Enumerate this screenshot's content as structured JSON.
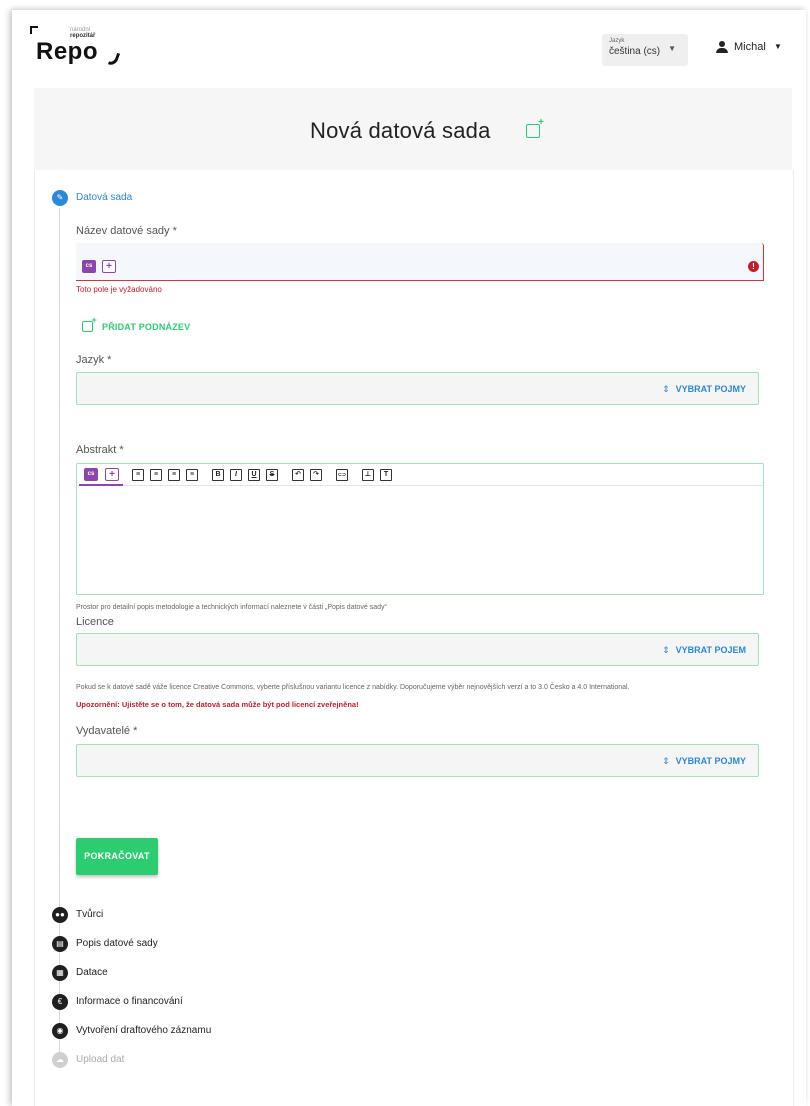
{
  "header": {
    "logo": {
      "small_line1": "národní",
      "small_line2": "repozitář",
      "name": "Repo"
    },
    "language": {
      "label": "Jazyk",
      "value": "čeština (cs)"
    },
    "user": {
      "name": "Michal"
    }
  },
  "page_title": "Nová datová sada",
  "steps": [
    {
      "label": "Datová sada",
      "state": "active"
    },
    {
      "label": "Tvůrci",
      "state": "pending"
    },
    {
      "label": "Popis datové sady",
      "state": "pending"
    },
    {
      "label": "Datace",
      "state": "pending"
    },
    {
      "label": "Informace o financování",
      "state": "pending"
    },
    {
      "label": "Vytvoření draftového záznamu",
      "state": "pending"
    },
    {
      "label": "Upload dat",
      "state": "disabled"
    }
  ],
  "form": {
    "name": {
      "label": "Název datové sady *",
      "lang_chip": "cs",
      "add_chip": "+",
      "error": "Toto pole je vyžadováno",
      "add_subtitle": "PŘIDAT PODNÁZEV"
    },
    "language": {
      "label": "Jazyk *",
      "action": "VYBRAT POJMY"
    },
    "abstract": {
      "label": "Abstrakt *",
      "lang_chip": "cs",
      "add_chip": "+",
      "help": "Prostor pro detailní popis metodologie a technických informací naleznete v části „Popis datové sady“",
      "toolbar": [
        "≡",
        "≡",
        "≡",
        "≡",
        "B",
        "I",
        "U",
        "S",
        "↶",
        "↷",
        "⊂⊃",
        "⊥",
        "T"
      ]
    },
    "license": {
      "label": "Licence",
      "action": "VYBRAT POJEM",
      "help": "Pokud se k datové sadě váže licence Creative Commons, vyberte příslušnou variantu licence z nabídky. Doporučujeme výběr nejnovějších verzí a to 3.0 Česko a 4.0 International.",
      "warning": "Upozornění: Ujistěte se o tom, že datová sada může být pod licencí zveřejněna!"
    },
    "publishers": {
      "label": "Vydavatelé *",
      "action": "VYBRAT POJMY"
    },
    "continue": "POKRAČOVAT"
  },
  "colors": {
    "accent_blue": "#2b87d8",
    "accent_green": "#2ecc71",
    "error_red": "#c0202a",
    "chip_purple": "#8e44ad"
  }
}
